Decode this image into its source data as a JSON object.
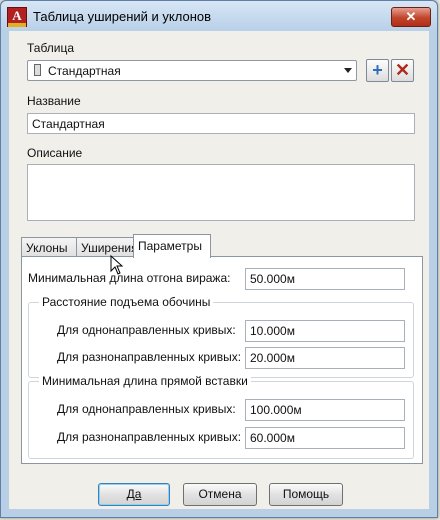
{
  "window": {
    "title": "Таблица уширений и уклонов",
    "close_symbol": "✕",
    "app_icon_letter": "A"
  },
  "table_section": {
    "label": "Таблица",
    "selected": "Стандартная",
    "add_symbol": "+",
    "delete_symbol": "✕"
  },
  "name_section": {
    "label": "Название",
    "value": "Стандартная"
  },
  "description_section": {
    "label": "Описание",
    "value": ""
  },
  "tabs": [
    {
      "label": "Уклоны",
      "active": false
    },
    {
      "label": "Уширения",
      "active": false
    },
    {
      "label": "Параметры",
      "active": true
    }
  ],
  "params": {
    "min_runout_label": "Минимальная длина отгона виража:",
    "min_runout_value": "50.000м",
    "shoulder_group": {
      "title": "Расстояние подъема обочины",
      "same_dir_label": "Для однонаправленных кривых:",
      "same_dir_value": "10.000м",
      "opp_dir_label": "Для разнонаправленных кривых:",
      "opp_dir_value": "20.000м"
    },
    "tangent_group": {
      "title": "Минимальная длина прямой вставки",
      "same_dir_label": "Для однонаправленных кривых:",
      "same_dir_value": "100.000м",
      "opp_dir_label": "Для разнонаправленных кривых:",
      "opp_dir_value": "60.000м"
    }
  },
  "buttons": {
    "ok": "Да",
    "cancel": "Отмена",
    "help": "Помощь"
  }
}
